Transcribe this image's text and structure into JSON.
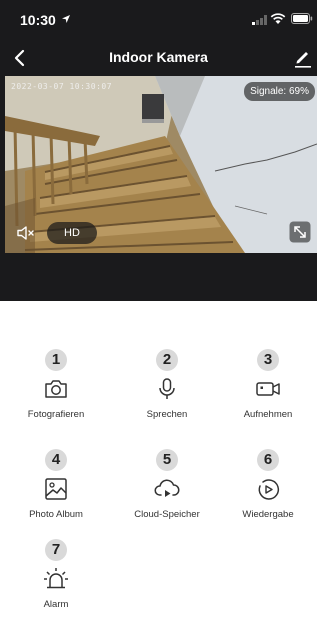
{
  "status_bar": {
    "time": "10:30"
  },
  "nav": {
    "title": "Indoor Kamera"
  },
  "feed": {
    "timestamp": "2022-03-07  10:30:07",
    "signal": "Signale: 69%",
    "quality": "HD"
  },
  "controls": [
    {
      "number": "1",
      "label": "Fotografieren"
    },
    {
      "number": "2",
      "label": "Sprechen"
    },
    {
      "number": "3",
      "label": "Aufnehmen"
    },
    {
      "number": "4",
      "label": "Photo Album"
    },
    {
      "number": "5",
      "label": "Cloud-Speicher"
    },
    {
      "number": "6",
      "label": "Wiedergabe"
    },
    {
      "number": "7",
      "label": "Alarm"
    }
  ]
}
